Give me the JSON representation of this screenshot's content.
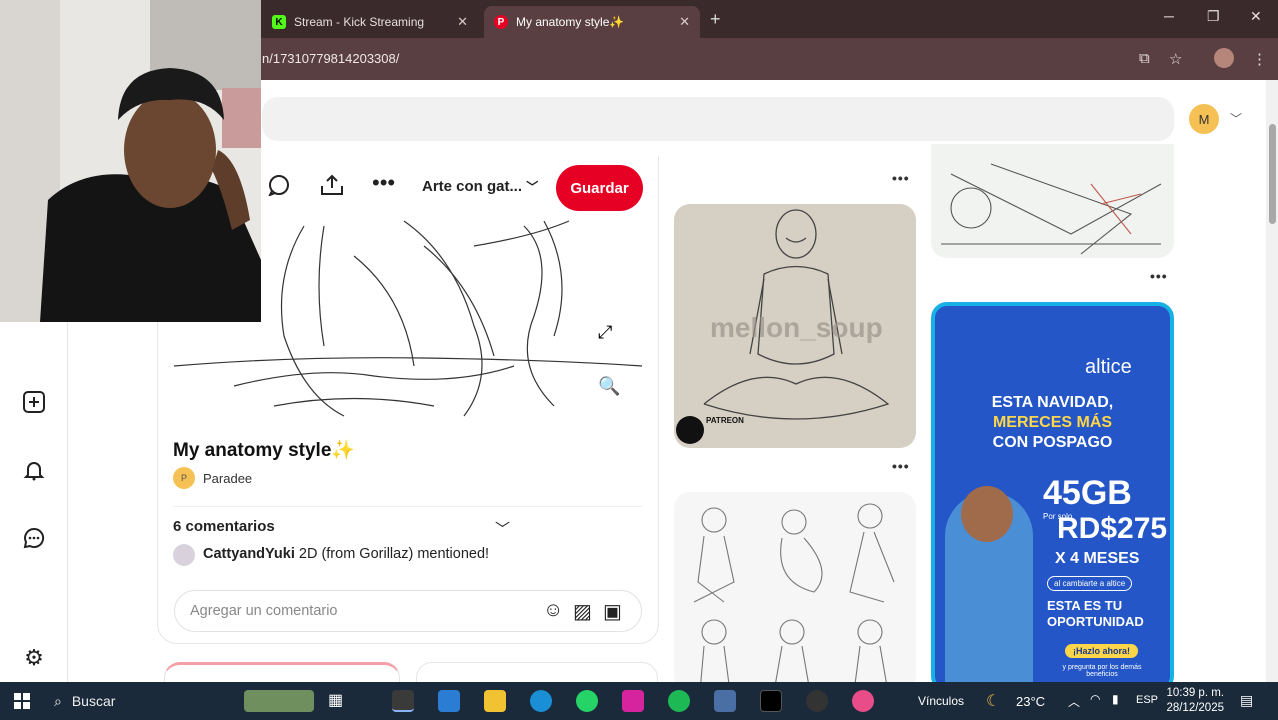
{
  "browser": {
    "tabs": [
      {
        "title": "Stream - Kick Streaming",
        "favicon": "kick-icon"
      },
      {
        "title": "My anatomy style✨",
        "favicon": "pinterest-icon",
        "active": true
      }
    ],
    "url": "n/17310779814203308/"
  },
  "header": {
    "avatar_letter": "M"
  },
  "pin": {
    "board": "Arte con gat...",
    "save_label": "Guardar",
    "title": "My anatomy style✨",
    "author_initial": "P",
    "author": "Paradee",
    "comments_count": "6 comentarios",
    "comment_user": "CattyandYuki",
    "comment_text": " 2D (from Gorillaz) mentioned!",
    "comment_placeholder": "Agregar un comentario"
  },
  "grid": {
    "watermark": "mellon_soup",
    "patreon_label": "PATREON",
    "ad": {
      "brand": "altice",
      "line1": "ESTA NAVIDAD,",
      "line2": "MERECES MÁS",
      "line3": "CON POSPAGO",
      "gb": "45GB",
      "por_solo": "Por solo",
      "price": "RD$275",
      "meses": "X 4 MESES",
      "chip": "al cambiarte a altice",
      "op1": "ESTA ES TU",
      "op2": "OPORTUNIDAD",
      "cta": "¡Hazlo ahora!",
      "fine": "y pregunta por los demás beneficios"
    }
  },
  "taskbar": {
    "search": "Buscar",
    "vinculos": "Vínculos",
    "temp": "23°C",
    "lang": "ESP",
    "time": "10:39 p. m.",
    "date": "28/12/2025"
  },
  "colors": {
    "pinterest_red": "#e60023",
    "tab_dark": "#3a2a2c",
    "addr": "#5a3f42",
    "ad_blue": "#2456c7"
  }
}
